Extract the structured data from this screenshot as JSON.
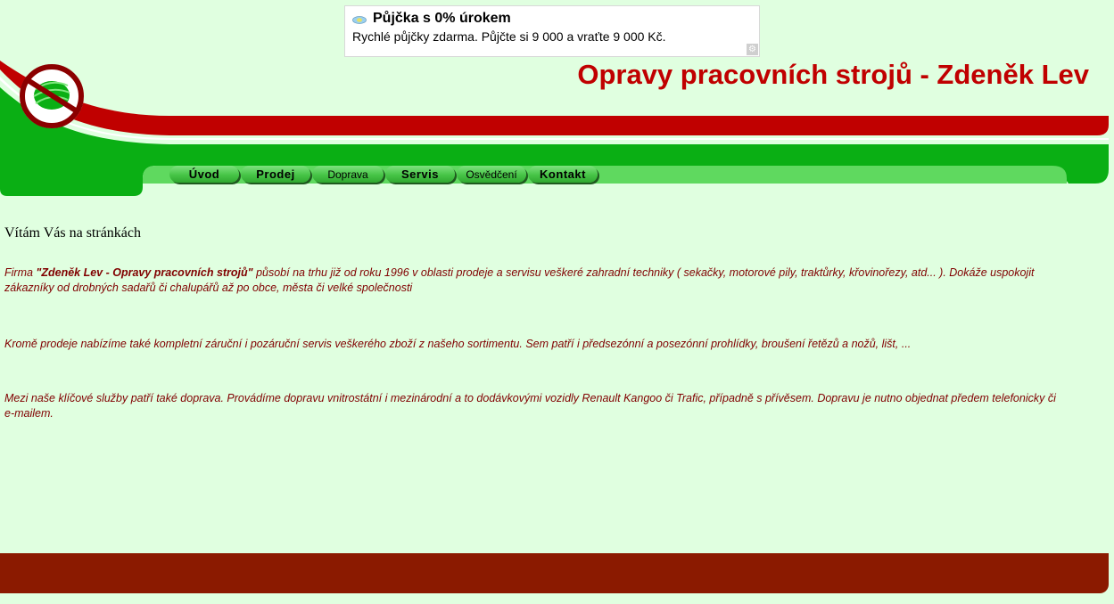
{
  "ad": {
    "title": "Půjčka s 0% úrokem",
    "text": "Rychlé půjčky zdarma. Půjčte si 9 000 a vraťte 9 000 Kč."
  },
  "header": {
    "site_title": "Opravy pracovních strojů - Zdeněk Lev"
  },
  "nav": {
    "items": [
      {
        "label": "Úvod"
      },
      {
        "label": "Prodej"
      },
      {
        "label": "Doprava"
      },
      {
        "label": "Servis"
      },
      {
        "label": "Osvědčení"
      },
      {
        "label": "Kontakt"
      }
    ]
  },
  "content": {
    "welcome": "Vítám Vás na stránkách",
    "p1_prefix": "Firma ",
    "p1_company": "\"Zdeněk Lev - Opravy pracovních strojů\"",
    "p1_rest": " působí na trhu již od roku 1996 v oblasti prodeje a servisu veškeré zahradní techniky ( sekačky, motorové pily, traktůrky, křovinořezy, atd... ). Dokáže uspokojit zákazníky od drobných sadařů či chalupářů až po obce, města či velké společnosti",
    "p2": "Kromě prodeje nabízíme také kompletní záruční i pozáruční servis veškerého zboží z našeho sortimentu. Sem patří i předsezónní a posezónní prohlídky, broušení řetězů a nožů, lišt, ...",
    "p3": "Mezi naše klíčové služby patří také doprava. Provádíme dopravu vnitrostátní i mezinárodní  a to dodávkovými vozidly Renault Kangoo či Trafic, případně s přívěsem. Dopravu je nutno objednat předem telefonicky či e-mailem."
  },
  "colors": {
    "background": "#e0ffe0",
    "title_red": "#c00000",
    "header_green": "#0aaf14",
    "nav_strip": "#5fd95f",
    "text_dark_red": "#800000",
    "footer": "#8b1a00"
  },
  "icons": {
    "logo": "green-leaf-circle-logo",
    "ad_icon": "money-icon",
    "ad_choices": "adchoices-icon"
  }
}
